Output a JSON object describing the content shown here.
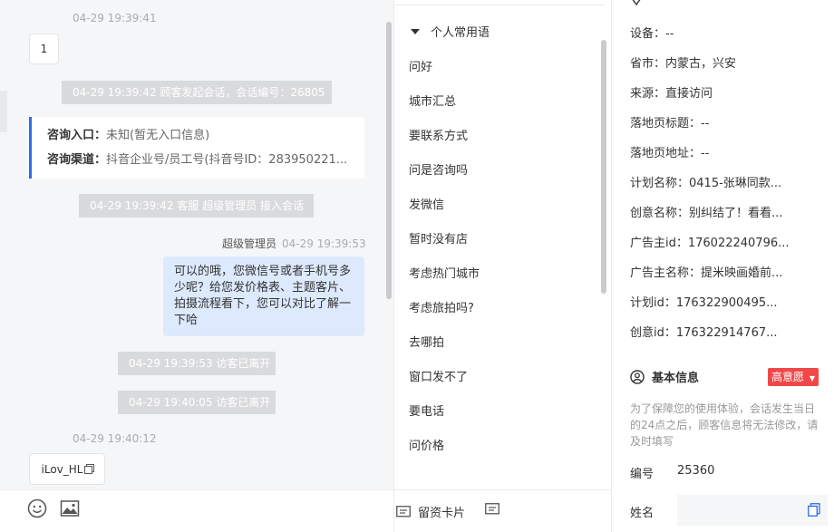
{
  "chat": {
    "ts1": "04-29 19:39:41",
    "msg1": "1",
    "sys1": "04-29 19:39:42 顾客发起会话，会话编号：26805",
    "entry_label": "咨询入口：",
    "entry_value": "未知(暂无入口信息)",
    "channel_label": "咨询渠道：",
    "channel_value": "抖音企业号/员工号(抖音号ID：283950221...",
    "sys2": "04-29 19:39:42 客服 超级管理员 接入会话",
    "agent_name": "超级管理员",
    "agent_time": "04-29 19:39:53",
    "agent_msg": "可以的哦，您微信号或者手机号多少呢？给您发价格表、主题客片、拍摄流程看下，您可以对比了解一下哈",
    "sys3": "04-29 19:39:53 访客已离开",
    "sys4": "04-29 19:40:05 访客已离开",
    "ts2": "04-29 19:40:12",
    "msg2": "iLov_HL"
  },
  "phrases": {
    "group": "个人常用语",
    "items": [
      "问好",
      "城市汇总",
      "要联系方式",
      "问是咨询吗",
      "发微信",
      "暂时没有店",
      "考虑热门城市",
      "考虑旅拍吗?",
      "去哪拍",
      "窗口发不了",
      "要电话",
      "问价格"
    ]
  },
  "bottom": {
    "card_label": "留资卡片",
    "collect_label": "收起图文常用语"
  },
  "customer": {
    "rows": [
      "设备：--",
      "省市：内蒙古，兴安",
      "来源：直接访问",
      "落地页标题：--",
      "落地页地址：--",
      "计划名称：0415-张琳同款...",
      "创意名称：别纠结了！看看...",
      "广告主id：176022240796...",
      "广告主名称：提米映画婚前...",
      "计划id：176322900495...",
      "创意id：176322914767..."
    ],
    "section_title": "基本信息",
    "intent": "高意愿",
    "notice": "为了保障您的使用体验，会话发生当日的24点之后，顾客信息将无法修改，请及时填写",
    "id_label": "编号",
    "id_value": "25360",
    "name_label": "姓名",
    "name_value": ""
  },
  "colors": {
    "accent": "#2f6bea",
    "badge": "#f04848",
    "agent_bubble": "#dde9fd"
  }
}
